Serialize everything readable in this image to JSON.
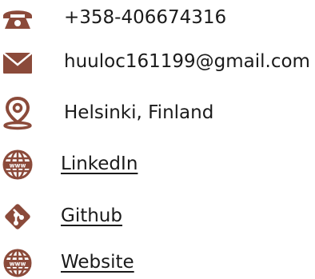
{
  "colors": {
    "icon": "#8B4A3A",
    "text": "#1a1a1a",
    "background": "#ffffff"
  },
  "contacts": [
    {
      "icon": "phone-icon",
      "text": "+358-406674316",
      "link": false
    },
    {
      "icon": "email-icon",
      "text": "huuloc161199@gmail.com",
      "link": false
    },
    {
      "icon": "location-pin-icon",
      "text": "Helsinki, Finland",
      "link": false
    },
    {
      "icon": "globe-www-icon",
      "text": "LinkedIn",
      "link": true
    },
    {
      "icon": "git-icon",
      "text": "Github",
      "link": true
    },
    {
      "icon": "globe-www-icon",
      "text": "Website",
      "link": true
    }
  ]
}
